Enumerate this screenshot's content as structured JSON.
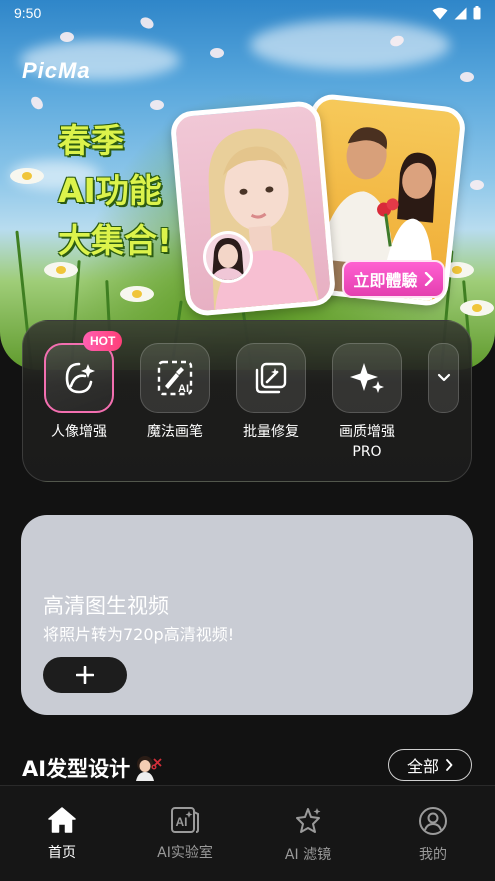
{
  "status_bar": {
    "time": "9:50"
  },
  "hero": {
    "brand": "PicMa",
    "headline_lines": [
      "春季",
      "AI功能",
      "大集合!"
    ],
    "cta_label": "立即體驗"
  },
  "tools": [
    {
      "label": "人像增强",
      "icon": "portrait-sparkle-icon",
      "badge": "HOT"
    },
    {
      "label": "魔法画笔",
      "icon": "ai-brush-icon"
    },
    {
      "label": "批量修复",
      "icon": "batch-magic-icon"
    },
    {
      "label": "画质增强",
      "label2": "PRO",
      "icon": "sparkles-icon"
    }
  ],
  "more_icon": "chevron-down-icon",
  "feature": {
    "title": "高清图生视频",
    "subtitle": "将照片转为720p高清视频!",
    "add_icon": "plus-icon"
  },
  "section": {
    "title": "AI发型设计",
    "see_all": "全部"
  },
  "bottom_nav": [
    {
      "label": "首页",
      "icon": "home-icon",
      "active": true
    },
    {
      "label": "AI实验室",
      "icon": "ai-lab-icon",
      "active": false
    },
    {
      "label": "AI 滤镜",
      "icon": "filter-star-icon",
      "active": false
    },
    {
      "label": "我的",
      "icon": "profile-icon",
      "active": false
    }
  ],
  "colors": {
    "headline": "#dcf34b",
    "cta": "#e43fb0",
    "hot_badge": "#ff3f78",
    "feature_card": "#c9ccd4",
    "background": "#121212"
  }
}
